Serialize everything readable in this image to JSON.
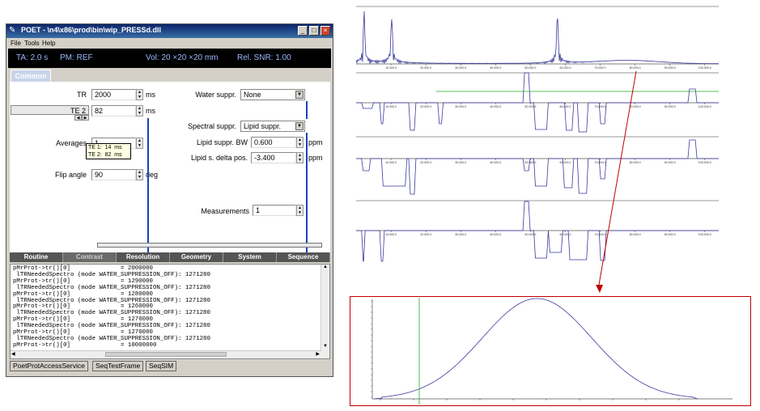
{
  "window": {
    "title": "POET - \\n4\\x86\\prod\\bin\\wip_PRESSd.dll",
    "menu": [
      "File",
      "Tools",
      "Help"
    ],
    "buttons": {
      "minimize": "_",
      "maximize": "□",
      "close": "×"
    }
  },
  "infobar": {
    "ta": "TA: 2.0 s",
    "pm": "PM: REF",
    "vol": "Vol: 20 ×20 ×20  mm",
    "snr": "Rel. SNR: 1.00"
  },
  "top_tab": "Common",
  "params": {
    "tr": {
      "label": "TR",
      "value": "2000",
      "unit": "ms"
    },
    "te": {
      "label": "TE 2",
      "value": "82",
      "unit": "ms"
    },
    "averages": {
      "label": "Averages",
      "value": "1"
    },
    "flip": {
      "label": "Flip angle",
      "value": "90",
      "unit": "deg"
    },
    "water": {
      "label": "Water suppr.",
      "value": "None"
    },
    "spectral": {
      "label": "Spectral suppr.",
      "value": "Lipid suppr."
    },
    "lipid_bw": {
      "label": "Lipid suppr. BW",
      "value": "0.600",
      "unit": "ppm"
    },
    "lipid_delta": {
      "label": "Lipid s. delta pos.",
      "value": "-3.400",
      "unit": "ppm"
    },
    "measurements": {
      "label": "Measurements",
      "value": "1"
    }
  },
  "tooltip": "TE 1:  14  ms\nTE 2:  82  ms",
  "tabs": [
    "Routine",
    "Contrast",
    "Resolution",
    "Geometry",
    "System",
    "Sequence"
  ],
  "active_tab": "Contrast",
  "log": "pMrProt->tr()[0]              = 2000000\n lTRNeededSpectro (mode WATER_SUPPRESSION_OFF): 1271280\npMrProt->tr()[0]              = 1290000\n lTRNeededSpectro (mode WATER_SUPPRESSION_OFF): 1271280\npMrProt->tr()[0]              = 1280000\n lTRNeededSpectro (mode WATER_SUPPRESSION_OFF): 1271280\npMrProt->tr()[0]              = 1260000\n lTRNeededSpectro (mode WATER_SUPPRESSION_OFF): 1271280\npMrProt->tr()[0]              = 1270000\n lTRNeededSpectro (mode WATER_SUPPRESSION_OFF): 1271280\npMrProt->tr()[0]              = 1270000\n lTRNeededSpectro (mode WATER_SUPPRESSION_OFF): 1271280\npMrProt->tr()[0]              = 10000000",
  "status_tabs": [
    "PoetProtAccessService",
    "SeqTestFrame",
    "SeqSIM"
  ],
  "x_ticks": [
    "10.000.0",
    "20.000.0",
    "30.000.0",
    "40.000.0",
    "50.000.0",
    "60.000.0",
    "70.000.0",
    "80.000.0",
    "90.000.0",
    "100.000.0"
  ],
  "colors": {
    "trace": "#3a3aa0",
    "guide": "#22aa22",
    "zoom_box": "#c00000",
    "arrow": "#c00000"
  }
}
